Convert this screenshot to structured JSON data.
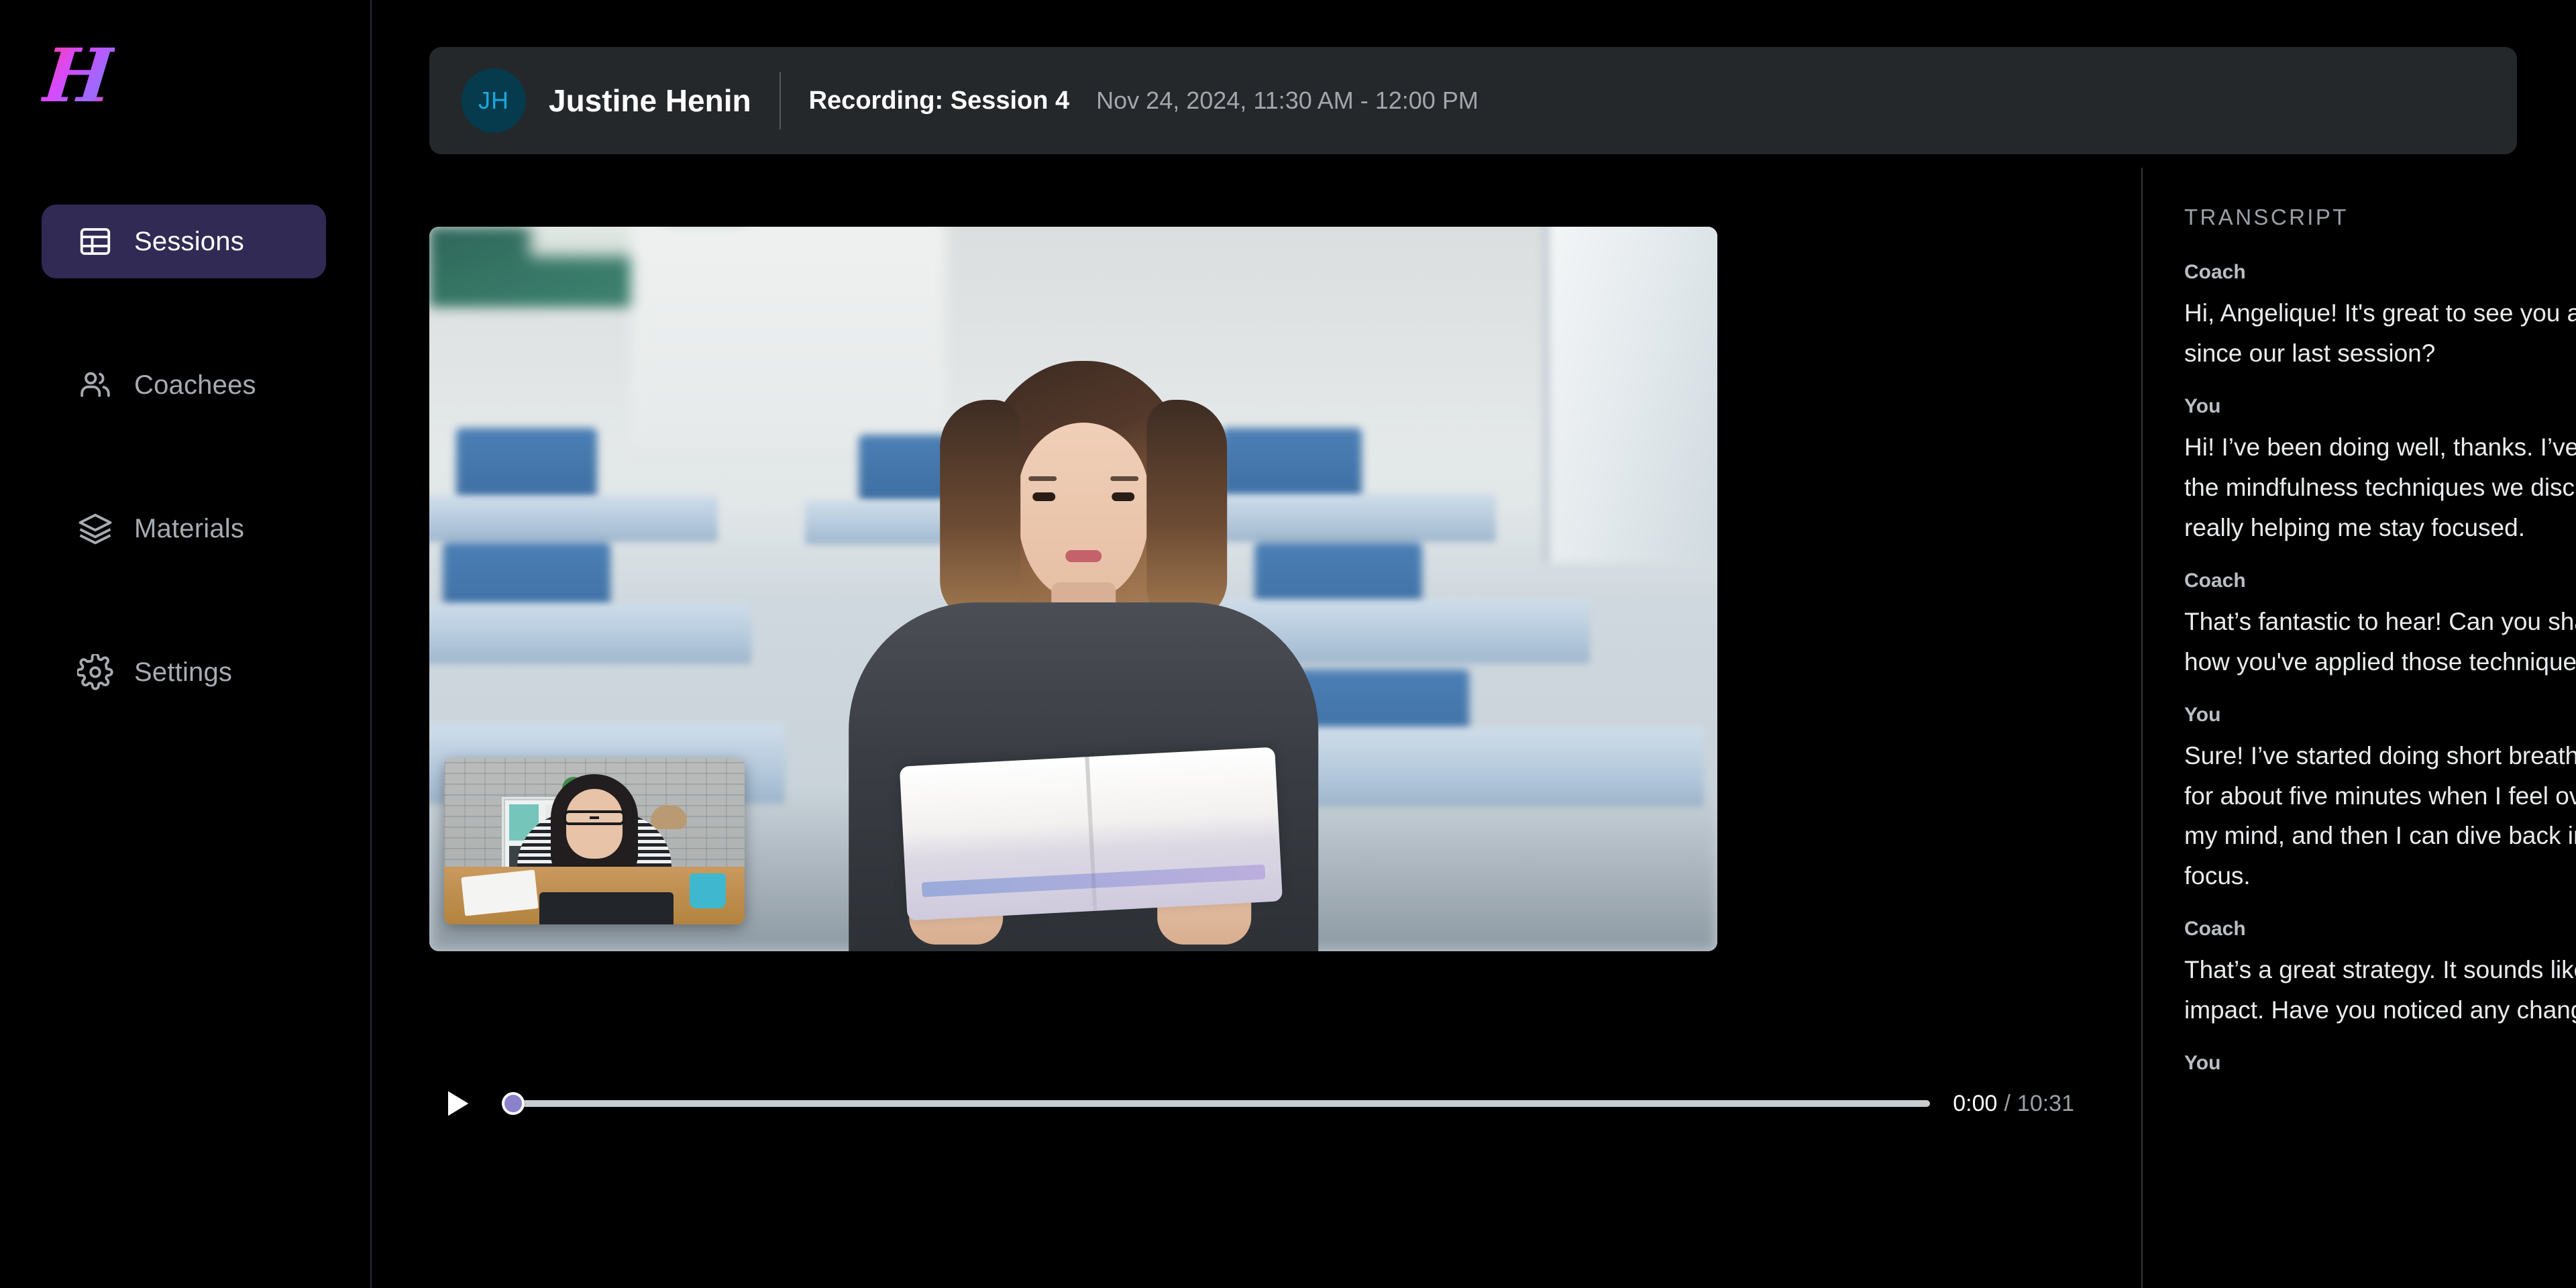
{
  "brand": {
    "logo_letter": "H",
    "logo_gradient_from": "#ff3d9a",
    "logo_gradient_to": "#9a6bff"
  },
  "sidebar": {
    "items": [
      {
        "label": "Sessions",
        "icon": "table-icon",
        "active": true
      },
      {
        "label": "Coachees",
        "icon": "users-icon",
        "active": false
      },
      {
        "label": "Materials",
        "icon": "layers-icon",
        "active": false
      },
      {
        "label": "Settings",
        "icon": "gear-icon",
        "active": false
      }
    ],
    "active_bg": "#312a55"
  },
  "header": {
    "avatar_initials": "JH",
    "avatar_bg": "#063a4d",
    "avatar_fg": "#1aa8dc",
    "person_name": "Justine Henin",
    "recording_title": "Recording: Session 4",
    "recording_date": "Nov 24, 2024, 11:30 AM - 12:00 PM"
  },
  "player": {
    "play_icon": "play-icon",
    "current_time": "0:00",
    "separator": "/",
    "duration": "10:31",
    "progress_percent": 0,
    "thumb_color": "#8b82cc",
    "track_color": "#c9ccd1"
  },
  "transcript": {
    "heading": "TRANSCRIPT",
    "entries": [
      {
        "speaker": "Coach",
        "text": "Hi, Angelique! It's great to see you again. How have you been since our last session?"
      },
      {
        "speaker": "You",
        "text": "Hi! I’ve been doing well, thanks. I’ve been trying to implement the mindfulness techniques we discussed, and I think they’re really helping me stay focused."
      },
      {
        "speaker": "Coach",
        "text": "That’s fantastic to hear! Can you share a specific example of how you've applied those techniques in your daily routine?"
      },
      {
        "speaker": "You",
        "text": "Sure! I’ve started doing short breathing exercises at my desk for about five minutes when I feel overwhelmed. It helps clear my mind, and then I can dive back into my work with better focus."
      },
      {
        "speaker": "Coach",
        "text": "That’s a great strategy. It sounds like it’s making a positive impact. Have you noticed any changes in your productivity?"
      },
      {
        "speaker": "You",
        "text": ""
      }
    ]
  }
}
